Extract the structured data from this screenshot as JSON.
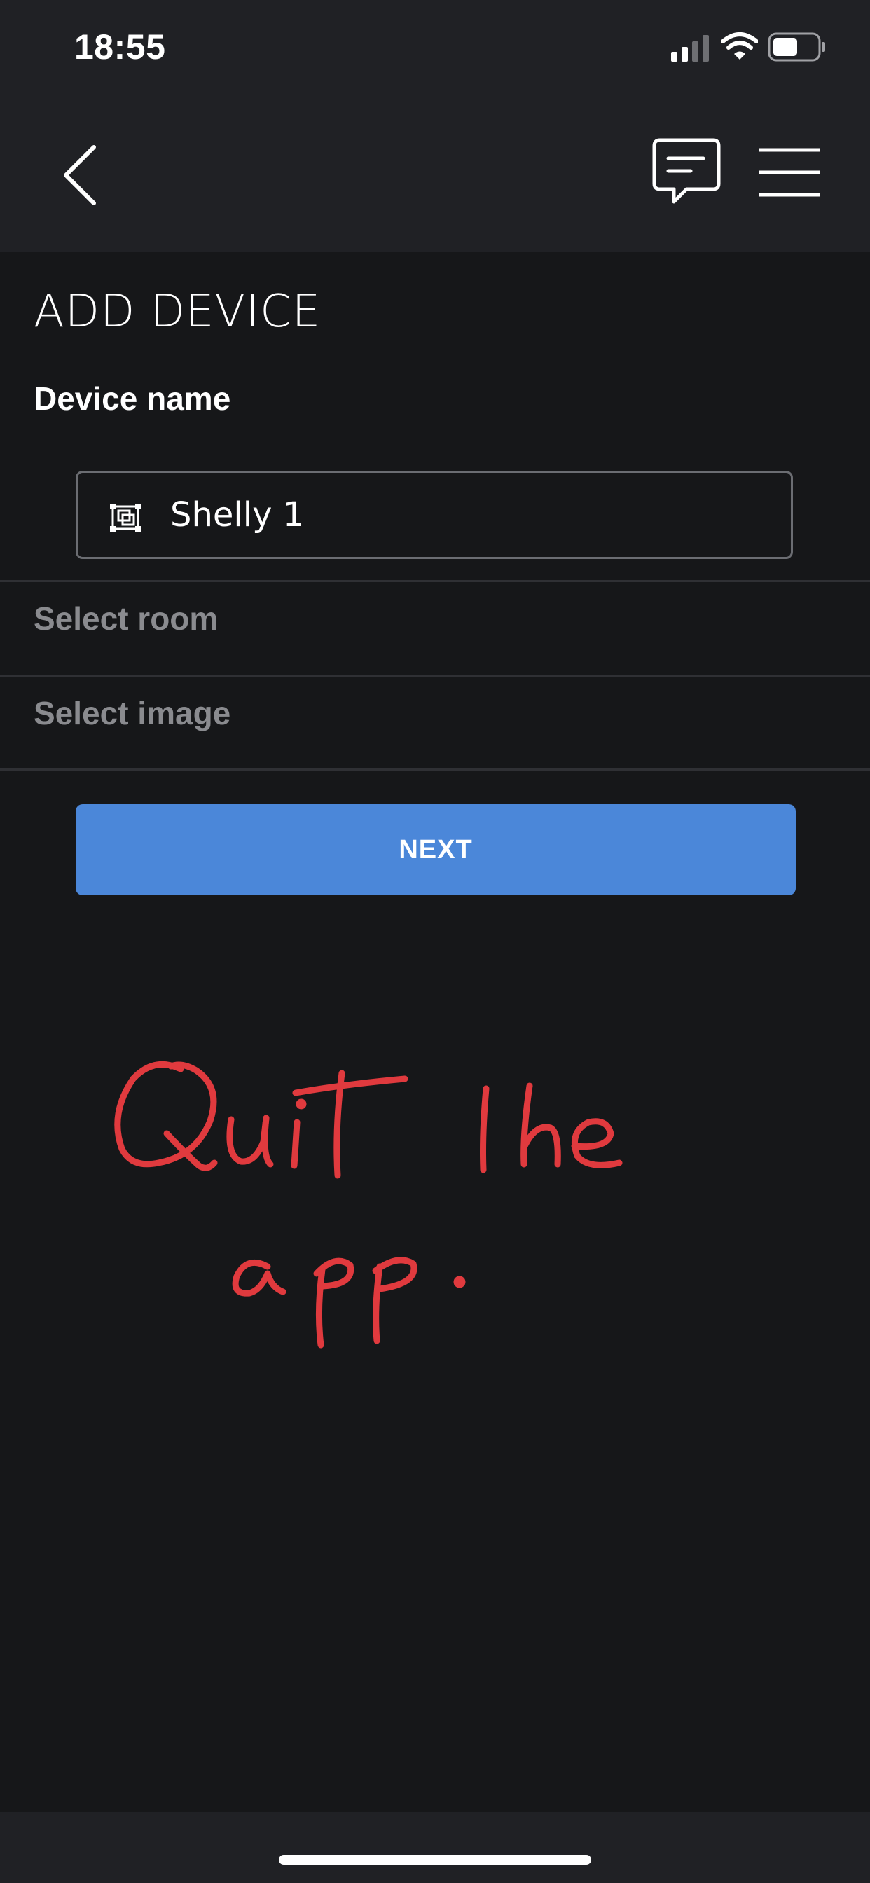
{
  "status_bar": {
    "time": "18:55",
    "icons": [
      "signal-icon",
      "wifi-icon",
      "battery-icon"
    ]
  },
  "nav_bar": {
    "icons": [
      "back-icon",
      "chat-icon",
      "menu-icon"
    ]
  },
  "page": {
    "title": "ADD DEVICE",
    "device_name_label": "Device name",
    "device_name_value": "Shelly 1",
    "device_icon": "device-icon",
    "select_room_label": "Select room",
    "select_image_label": "Select image",
    "next_label": "NEXT"
  },
  "annotation": {
    "handwritten_text": "Quit the app.",
    "color": "#e03a3e"
  },
  "colors": {
    "background": "#161719",
    "bar_background": "#202125",
    "accent": "#4b87d9",
    "muted_text": "#8a8b8f"
  }
}
